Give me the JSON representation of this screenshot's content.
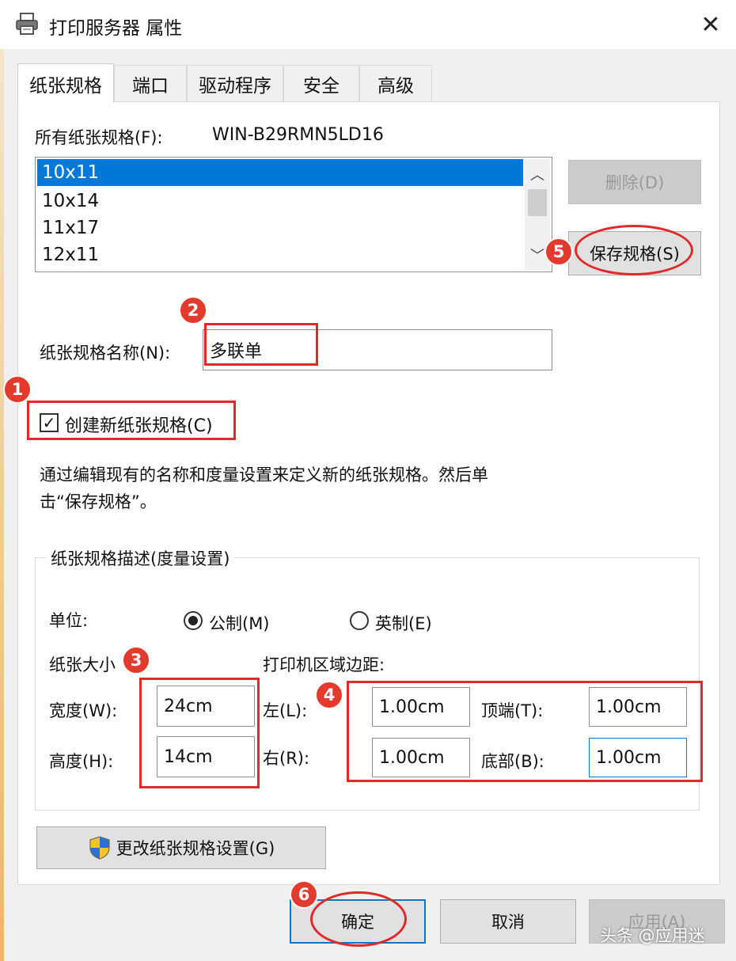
{
  "window": {
    "title": "打印服务器 属性",
    "close_glyph": "✕"
  },
  "tabs": [
    {
      "label": "纸张规格"
    },
    {
      "label": "端口"
    },
    {
      "label": "驱动程序"
    },
    {
      "label": "安全"
    },
    {
      "label": "高级"
    }
  ],
  "forms": {
    "all_forms_label": "所有纸张规格(F):",
    "server_name": "WIN-B29RMN5LD16",
    "form_list": [
      "10x11",
      "10x14",
      "11x17",
      "12x11"
    ],
    "selected_form": "10x11",
    "delete_button": "删除(D)",
    "save_button": "保存规格(S)",
    "form_name_label": "纸张规格名称(N):",
    "form_name_value": "多联单",
    "create_new_label": "创建新纸张规格(C)",
    "create_new_checked": true,
    "description": [
      "通过编辑现有的名称和度量设置来定义新的纸张规格。然后单",
      "击“保存规格”。"
    ]
  },
  "measurements": {
    "group_label": "纸张规格描述(度量设置)",
    "units_label": "单位:",
    "metric_label": "公制(M)",
    "english_label": "英制(E)",
    "selected_unit": "metric",
    "paper_size_label": "纸张大小",
    "width_label": "宽度(W):",
    "width_value": "24cm",
    "height_label": "高度(H):",
    "height_value": "14cm",
    "margins_label": "打印机区域边距:",
    "left_label": "左(L):",
    "left_value": "1.00cm",
    "right_label": "右(R):",
    "right_value": "1.00cm",
    "top_label": "顶端(T):",
    "top_value": "1.00cm",
    "bottom_label": "底部(B):",
    "bottom_value": "1.00cm"
  },
  "change_settings_button": "更改纸张规格设置(G)",
  "footer": {
    "ok": "确定",
    "cancel": "取消",
    "apply": "应用(A)"
  },
  "annotations": {
    "badges": [
      "1",
      "2",
      "3",
      "4",
      "5",
      "6"
    ],
    "color": "#e02a2a"
  },
  "watermark": "头条 @应用迷",
  "colors": {
    "selection": "#0078d7",
    "dialog_bg": "#f0f0f0",
    "panel_bg": "#ffffff"
  }
}
